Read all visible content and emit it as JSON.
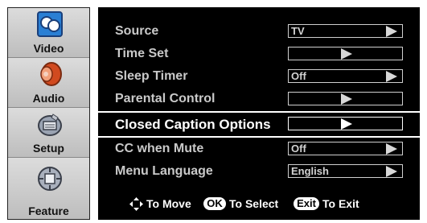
{
  "sidebar": {
    "items": [
      {
        "label": "Video",
        "icon": "video-icon"
      },
      {
        "label": "Audio",
        "icon": "speaker-icon"
      },
      {
        "label": "Setup",
        "icon": "setup-icon"
      },
      {
        "label": "Feature",
        "icon": "feature-icon"
      }
    ]
  },
  "menu": {
    "rows": [
      {
        "label": "Source",
        "value": "TV"
      },
      {
        "label": "Time Set",
        "value": ""
      },
      {
        "label": "Sleep Timer",
        "value": "Off"
      },
      {
        "label": "Parental Control",
        "value": ""
      },
      {
        "label": "Closed Caption Options",
        "value": ""
      },
      {
        "label": "CC when Mute",
        "value": "Off"
      },
      {
        "label": "Menu Language",
        "value": "English"
      }
    ]
  },
  "help": {
    "move_label": "To Move",
    "ok_key": "OK",
    "select_label": "To Select",
    "exit_key": "Exit",
    "exit_label": "To Exit"
  },
  "colors": {
    "panel_bg": "#000000",
    "sidebar_bg": "#c8c8c8",
    "row_text": "#c9c9c9",
    "selected_text": "#ffffff"
  }
}
